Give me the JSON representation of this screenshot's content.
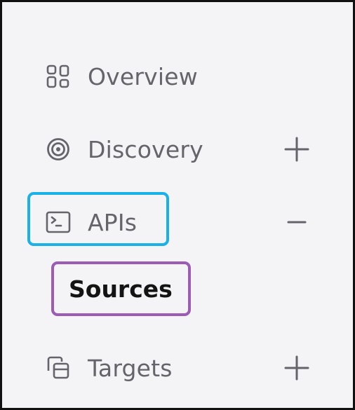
{
  "nav": {
    "items": [
      {
        "label": "Overview",
        "icon": "grid-icon",
        "toggle": null
      },
      {
        "label": "Discovery",
        "icon": "target-icon",
        "toggle": "+"
      },
      {
        "label": "APIs",
        "icon": "terminal-icon",
        "toggle": "−",
        "expanded": true,
        "children": [
          {
            "label": "Sources"
          }
        ]
      },
      {
        "label": "Targets",
        "icon": "copy-icon",
        "toggle": "+"
      }
    ]
  },
  "colors": {
    "background": "#f4f4f6",
    "label": "#64646a",
    "active_label": "#141414",
    "highlight_blue": "#1ab0e8",
    "highlight_purple": "#9c5cb6"
  }
}
